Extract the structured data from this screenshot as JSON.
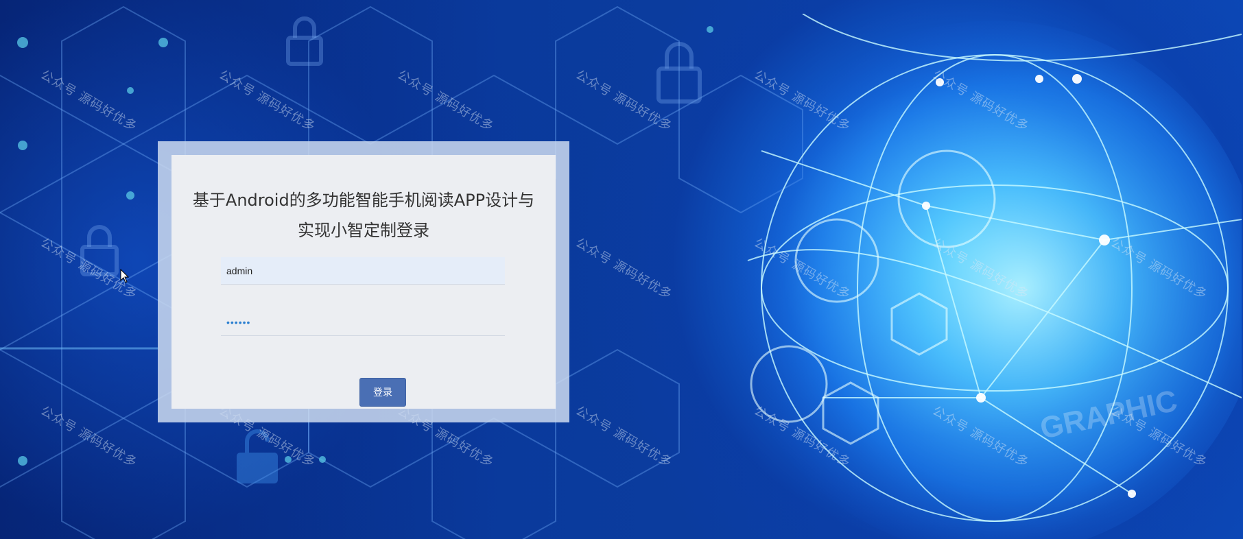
{
  "login": {
    "title": "基于Android的多功能智能手机阅读APP设计与实现小智定制登录",
    "username_value": "admin",
    "password_value": "••••••",
    "login_button_label": "登录"
  },
  "watermark": {
    "text": "公众号 源码好优多"
  },
  "colors": {
    "background_dark": "#05226e",
    "background_bright": "#3cb0ff",
    "card_outer": "#cddaf0",
    "card_inner": "#eceef2",
    "button": "#4a6fb4"
  }
}
